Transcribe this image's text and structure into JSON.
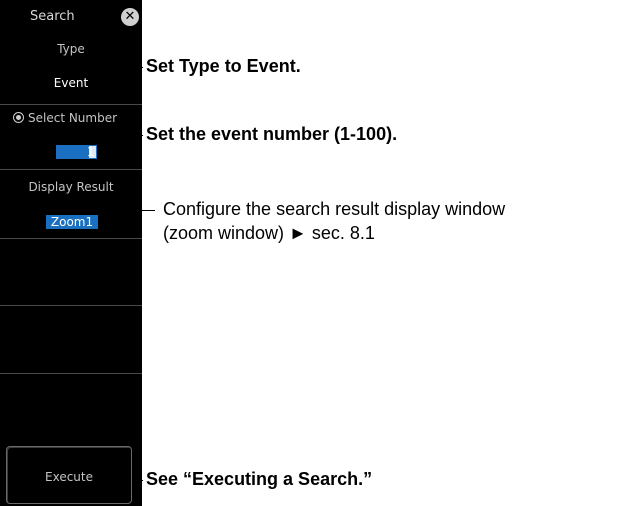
{
  "panel": {
    "title": "Search",
    "close_glyph": "✕",
    "type": {
      "label": "Type",
      "value": "Event"
    },
    "select_number": {
      "label": "Select Number",
      "value": "1"
    },
    "display_result": {
      "label": "Display Result",
      "value": "Zoom1"
    },
    "execute": {
      "label": "Execute"
    }
  },
  "callouts": {
    "type": "Set Type to Event.",
    "select_number": "Set the event number (1-100).",
    "display_result_line1": "Configure the search result display window",
    "display_result_line2": "(zoom window) ► sec. 8.1",
    "execute": "See “Executing a Search.”"
  },
  "colors": {
    "panel_bg": "#000000",
    "field_highlight": "#1a6fc0",
    "label_text": "#c4c4c4"
  },
  "icons": {
    "close": "close-icon",
    "radio": "radio-selected-icon"
  }
}
